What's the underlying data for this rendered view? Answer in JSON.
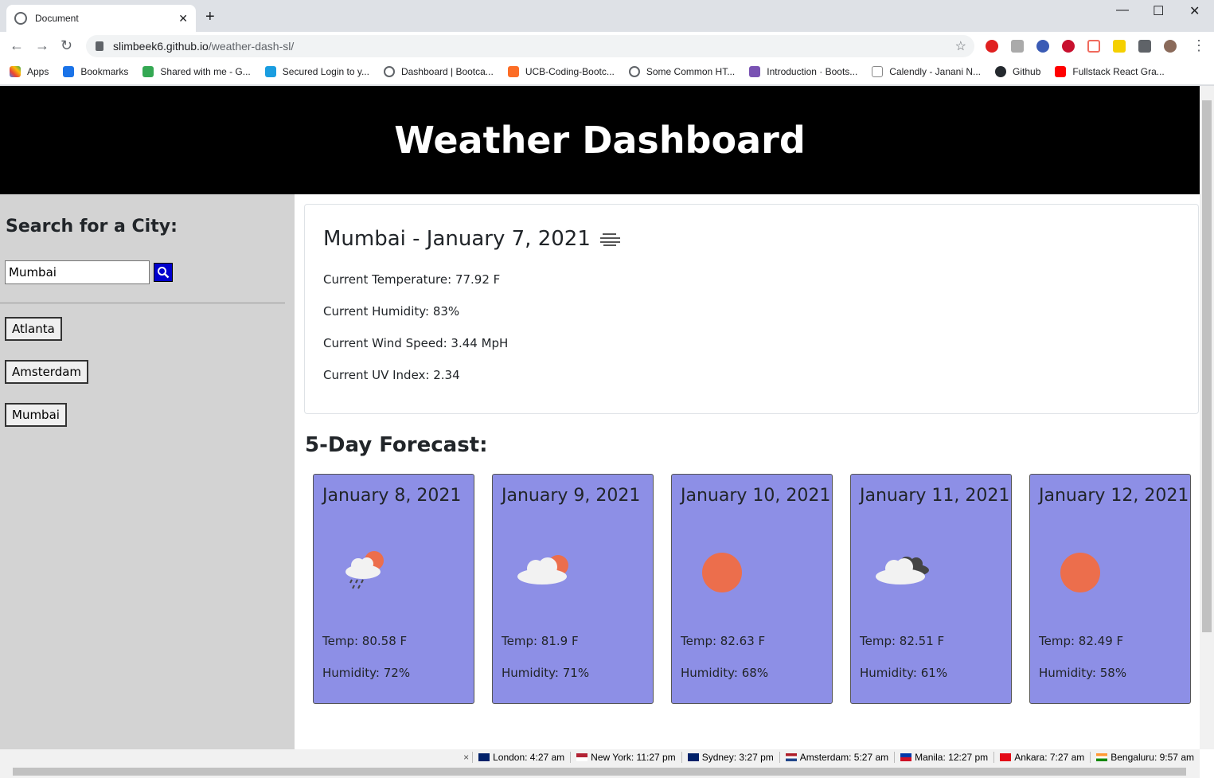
{
  "browser": {
    "tab_title": "Document",
    "url_host": "slimbeek6.github.io",
    "url_path": "/weather-dash-sl/",
    "bookmarks": [
      "Apps",
      "Bookmarks",
      "Shared with me - G...",
      "Secured Login to y...",
      "Dashboard | Bootca...",
      "UCB-Coding-Bootc...",
      "Some Common HT...",
      "Introduction · Boots...",
      "Calendly - Janani N...",
      "Github",
      "Fullstack React Gra..."
    ]
  },
  "header": {
    "title": "Weather Dashboard"
  },
  "sidebar": {
    "heading": "Search for a City:",
    "search_value": "Mumbai",
    "history": [
      "Atlanta",
      "Amsterdam",
      "Mumbai"
    ]
  },
  "current": {
    "title": "Mumbai - January 7, 2021",
    "icon": "mist-icon",
    "temperature": "Current Temperature: 77.92 F",
    "humidity": "Current Humidity: 83%",
    "wind": "Current Wind Speed: 3.44 MpH",
    "uv": "Current UV Index: 2.34"
  },
  "forecast": {
    "title": "5-Day Forecast:",
    "days": [
      {
        "date": "January 8, 2021",
        "icon": "rain-sun-icon",
        "temp": "Temp: 80.58 F",
        "humidity": "Humidity: 72%"
      },
      {
        "date": "January 9, 2021",
        "icon": "cloud-sun-icon",
        "temp": "Temp: 81.9 F",
        "humidity": "Humidity: 71%"
      },
      {
        "date": "January 10, 2021",
        "icon": "sun-icon",
        "temp": "Temp: 82.63 F",
        "humidity": "Humidity: 68%"
      },
      {
        "date": "January 11, 2021",
        "icon": "broken-clouds-icon",
        "temp": "Temp: 82.51 F",
        "humidity": "Humidity: 61%"
      },
      {
        "date": "January 12, 2021",
        "icon": "sun-icon",
        "temp": "Temp: 82.49 F",
        "humidity": "Humidity: 58%"
      }
    ]
  },
  "status_clocks": [
    "London: 4:27 am",
    "New York: 11:27 pm",
    "Sydney: 3:27 pm",
    "Amsterdam: 5:27 am",
    "Manila: 12:27 pm",
    "Ankara: 7:27 am",
    "Bengaluru: 9:57 am"
  ],
  "colors": {
    "accent_card": "#8d8fe6",
    "sun": "#ec6e4c",
    "search_button": "#0000cd"
  }
}
